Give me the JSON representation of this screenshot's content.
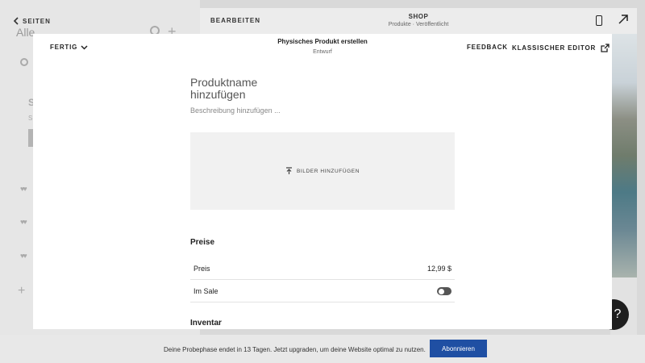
{
  "background": {
    "back_label": "SEITEN",
    "sidebar_title_hint": "Alle",
    "sidebar_s": "S",
    "sidebar_s2": "S",
    "topbar": {
      "edit_label": "BEARBEITEN",
      "shop_title": "SHOP",
      "shop_subtitle": "Produkte · Veröffentlicht"
    },
    "help_label": "?"
  },
  "modal": {
    "done_label": "FERTIG",
    "title": "Physisches Produkt erstellen",
    "subtitle": "Entwurf",
    "feedback_label": "FEEDBACK",
    "classic_editor_label": "KLASSISCHER EDITOR",
    "product_name_placeholder": "Produktname hinzufügen",
    "description_placeholder": "Beschreibung hinzufügen ...",
    "add_images_label": "BILDER HINZUFÜGEN",
    "prices_heading": "Preise",
    "price_label": "Preis",
    "price_value": "12,99 $",
    "sale_label": "Im Sale",
    "sale_enabled": false,
    "inventory_heading": "Inventar"
  },
  "trial": {
    "message": "Deine Probephase endet in 13 Tagen. Jetzt upgraden, um deine Website optimal zu nutzen.",
    "subscribe_label": "Abonnieren"
  },
  "colors": {
    "accent": "#1f4fa3",
    "toggle_off": "#555555"
  }
}
